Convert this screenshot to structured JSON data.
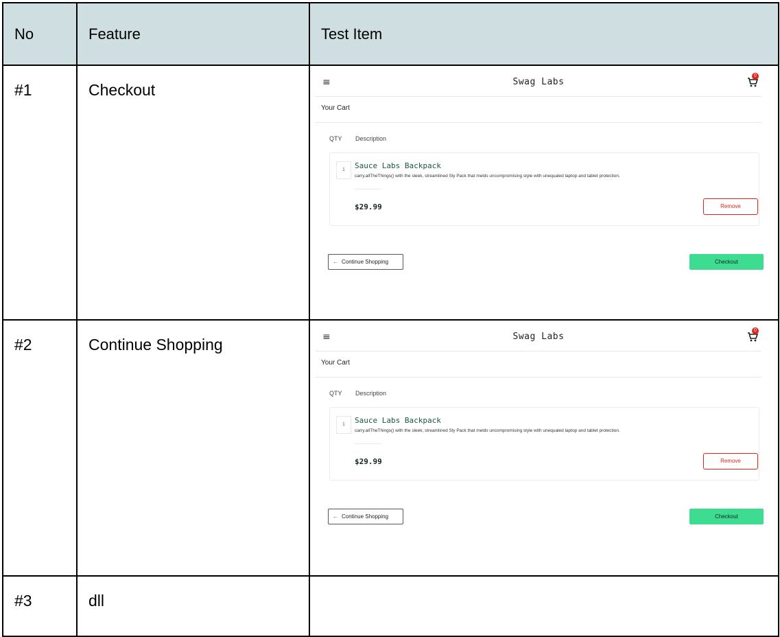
{
  "table": {
    "headers": [
      "No",
      "Feature",
      "Test Item"
    ],
    "rows": [
      {
        "no": "#1",
        "feature": "Checkout"
      },
      {
        "no": "#2",
        "feature": "Continue Shopping"
      },
      {
        "no": "#3",
        "feature": "dll"
      }
    ]
  },
  "screenshot": {
    "menu_icon": "hamburger-menu-icon",
    "brand": "Swag Labs",
    "cart_icon": "shopping-cart-icon",
    "cart_badge": "0",
    "page_title": "Your Cart",
    "qty_header": "QTY",
    "description_header": "Description",
    "item": {
      "quantity": "1",
      "name": "Sauce Labs Backpack",
      "description": "carry.allTheThings() with the sleek, streamlined Sly Pack that melds uncompromising style with unequaled laptop and tablet protection.",
      "price": "$29.99",
      "remove_label": "Remove"
    },
    "continue_label": "Continue Shopping",
    "continue_arrow": "←",
    "checkout_label": "Checkout"
  },
  "colors": {
    "header_bg": "#cfdfe1",
    "checkout_green": "#3ddc91",
    "remove_red": "#e2231a",
    "item_name_green": "#18583a"
  }
}
